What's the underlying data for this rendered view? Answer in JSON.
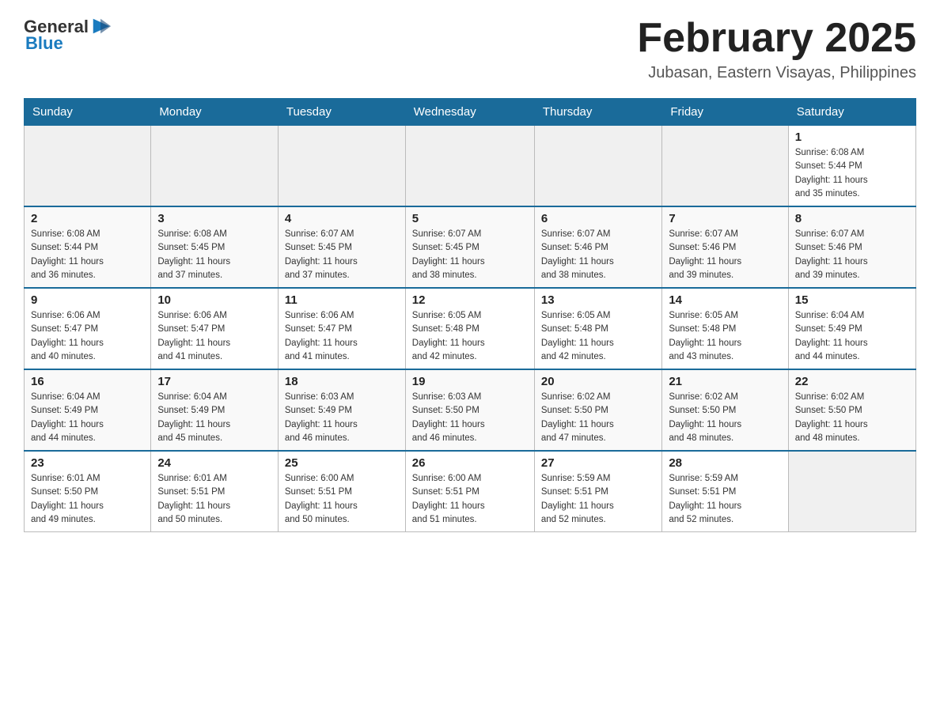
{
  "header": {
    "logo_general": "General",
    "logo_blue": "Blue",
    "month_title": "February 2025",
    "location": "Jubasan, Eastern Visayas, Philippines"
  },
  "days_of_week": [
    "Sunday",
    "Monday",
    "Tuesday",
    "Wednesday",
    "Thursday",
    "Friday",
    "Saturday"
  ],
  "weeks": [
    [
      {
        "day": "",
        "info": ""
      },
      {
        "day": "",
        "info": ""
      },
      {
        "day": "",
        "info": ""
      },
      {
        "day": "",
        "info": ""
      },
      {
        "day": "",
        "info": ""
      },
      {
        "day": "",
        "info": ""
      },
      {
        "day": "1",
        "info": "Sunrise: 6:08 AM\nSunset: 5:44 PM\nDaylight: 11 hours\nand 35 minutes."
      }
    ],
    [
      {
        "day": "2",
        "info": "Sunrise: 6:08 AM\nSunset: 5:44 PM\nDaylight: 11 hours\nand 36 minutes."
      },
      {
        "day": "3",
        "info": "Sunrise: 6:08 AM\nSunset: 5:45 PM\nDaylight: 11 hours\nand 37 minutes."
      },
      {
        "day": "4",
        "info": "Sunrise: 6:07 AM\nSunset: 5:45 PM\nDaylight: 11 hours\nand 37 minutes."
      },
      {
        "day": "5",
        "info": "Sunrise: 6:07 AM\nSunset: 5:45 PM\nDaylight: 11 hours\nand 38 minutes."
      },
      {
        "day": "6",
        "info": "Sunrise: 6:07 AM\nSunset: 5:46 PM\nDaylight: 11 hours\nand 38 minutes."
      },
      {
        "day": "7",
        "info": "Sunrise: 6:07 AM\nSunset: 5:46 PM\nDaylight: 11 hours\nand 39 minutes."
      },
      {
        "day": "8",
        "info": "Sunrise: 6:07 AM\nSunset: 5:46 PM\nDaylight: 11 hours\nand 39 minutes."
      }
    ],
    [
      {
        "day": "9",
        "info": "Sunrise: 6:06 AM\nSunset: 5:47 PM\nDaylight: 11 hours\nand 40 minutes."
      },
      {
        "day": "10",
        "info": "Sunrise: 6:06 AM\nSunset: 5:47 PM\nDaylight: 11 hours\nand 41 minutes."
      },
      {
        "day": "11",
        "info": "Sunrise: 6:06 AM\nSunset: 5:47 PM\nDaylight: 11 hours\nand 41 minutes."
      },
      {
        "day": "12",
        "info": "Sunrise: 6:05 AM\nSunset: 5:48 PM\nDaylight: 11 hours\nand 42 minutes."
      },
      {
        "day": "13",
        "info": "Sunrise: 6:05 AM\nSunset: 5:48 PM\nDaylight: 11 hours\nand 42 minutes."
      },
      {
        "day": "14",
        "info": "Sunrise: 6:05 AM\nSunset: 5:48 PM\nDaylight: 11 hours\nand 43 minutes."
      },
      {
        "day": "15",
        "info": "Sunrise: 6:04 AM\nSunset: 5:49 PM\nDaylight: 11 hours\nand 44 minutes."
      }
    ],
    [
      {
        "day": "16",
        "info": "Sunrise: 6:04 AM\nSunset: 5:49 PM\nDaylight: 11 hours\nand 44 minutes."
      },
      {
        "day": "17",
        "info": "Sunrise: 6:04 AM\nSunset: 5:49 PM\nDaylight: 11 hours\nand 45 minutes."
      },
      {
        "day": "18",
        "info": "Sunrise: 6:03 AM\nSunset: 5:49 PM\nDaylight: 11 hours\nand 46 minutes."
      },
      {
        "day": "19",
        "info": "Sunrise: 6:03 AM\nSunset: 5:50 PM\nDaylight: 11 hours\nand 46 minutes."
      },
      {
        "day": "20",
        "info": "Sunrise: 6:02 AM\nSunset: 5:50 PM\nDaylight: 11 hours\nand 47 minutes."
      },
      {
        "day": "21",
        "info": "Sunrise: 6:02 AM\nSunset: 5:50 PM\nDaylight: 11 hours\nand 48 minutes."
      },
      {
        "day": "22",
        "info": "Sunrise: 6:02 AM\nSunset: 5:50 PM\nDaylight: 11 hours\nand 48 minutes."
      }
    ],
    [
      {
        "day": "23",
        "info": "Sunrise: 6:01 AM\nSunset: 5:50 PM\nDaylight: 11 hours\nand 49 minutes."
      },
      {
        "day": "24",
        "info": "Sunrise: 6:01 AM\nSunset: 5:51 PM\nDaylight: 11 hours\nand 50 minutes."
      },
      {
        "day": "25",
        "info": "Sunrise: 6:00 AM\nSunset: 5:51 PM\nDaylight: 11 hours\nand 50 minutes."
      },
      {
        "day": "26",
        "info": "Sunrise: 6:00 AM\nSunset: 5:51 PM\nDaylight: 11 hours\nand 51 minutes."
      },
      {
        "day": "27",
        "info": "Sunrise: 5:59 AM\nSunset: 5:51 PM\nDaylight: 11 hours\nand 52 minutes."
      },
      {
        "day": "28",
        "info": "Sunrise: 5:59 AM\nSunset: 5:51 PM\nDaylight: 11 hours\nand 52 minutes."
      },
      {
        "day": "",
        "info": ""
      }
    ]
  ]
}
